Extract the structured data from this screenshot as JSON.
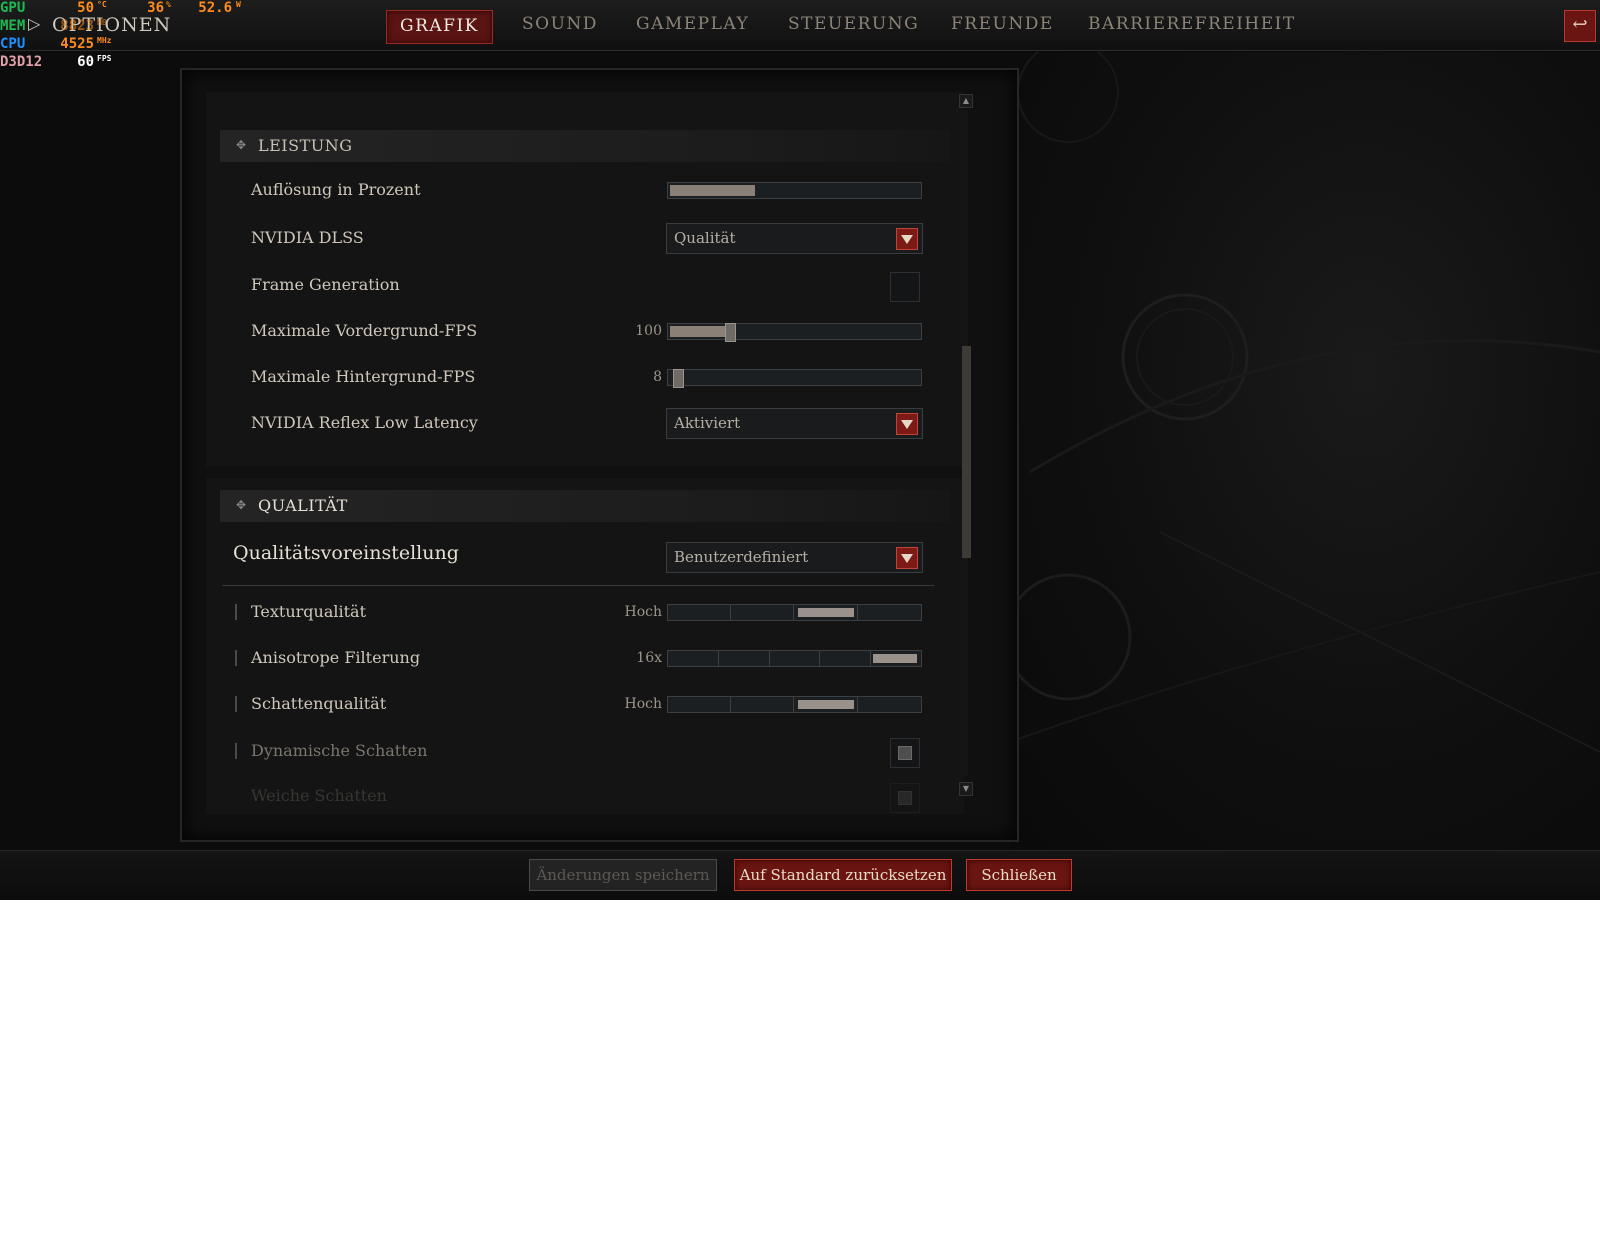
{
  "window": {
    "title": "OPTIONEN"
  },
  "tabs": [
    {
      "label": "GRAFIK",
      "active": true
    },
    {
      "label": "SOUND",
      "active": false
    },
    {
      "label": "GAMEPLAY",
      "active": false
    },
    {
      "label": "STEUERUNG",
      "active": false
    },
    {
      "label": "FREUNDE",
      "active": false
    },
    {
      "label": "BARRIEREFREIHEIT",
      "active": false
    }
  ],
  "back_icon": "return-arrow-icon",
  "perf_overlay": {
    "gpu": {
      "label": "GPU",
      "temp": "50",
      "temp_unit": "°C",
      "load": "36",
      "load_unit": "%",
      "power": "52.6",
      "power_unit": "W"
    },
    "mem": {
      "label": "MEM",
      "value": "8823",
      "unit": "MB"
    },
    "cpu": {
      "label": "CPU",
      "value": "4525",
      "unit": "MHz"
    },
    "api": {
      "label": "D3D12",
      "value": "60",
      "unit": "FPS"
    },
    "colors": {
      "gpu": "#1db954",
      "mem": "#1db954",
      "cpu": "#1e90ff",
      "api": "#e0a0a8",
      "value": "#ff8c1a"
    }
  },
  "sections": {
    "leistung": {
      "title": "LEISTUNG",
      "rows": {
        "aufloesung": {
          "label": "Auflösung in Prozent",
          "fill_fraction": 0.34
        },
        "dlss": {
          "label": "NVIDIA DLSS",
          "selected": "Qualität"
        },
        "framegen": {
          "label": "Frame Generation",
          "checked": false
        },
        "vordergrund": {
          "label": "Maximale Vordergrund-FPS",
          "value": "100",
          "fraction": 0.23
        },
        "hintergrund": {
          "label": "Maximale Hintergrund-FPS",
          "value": "8",
          "fraction": 0.02
        },
        "reflex": {
          "label": "NVIDIA Reflex Low Latency",
          "selected": "Aktiviert"
        }
      }
    },
    "qualitaet": {
      "title": "QUALITÄT",
      "preset": {
        "label": "Qualitätsvoreinstellung",
        "selected": "Benutzerdefiniert"
      },
      "rows": {
        "textur": {
          "label": "Texturqualität",
          "value": "Hoch",
          "steps": 4,
          "level": 3
        },
        "aniso": {
          "label": "Anisotrope Filterung",
          "value": "16x",
          "steps": 5,
          "level": 5
        },
        "schatten": {
          "label": "Schattenqualität",
          "value": "Hoch",
          "steps": 4,
          "level": 3
        },
        "dynschatten": {
          "label": "Dynamische Schatten",
          "checked": true
        },
        "weicheschatten": {
          "label": "Weiche Schatten"
        }
      }
    }
  },
  "footer": {
    "save_label": "Änderungen speichern",
    "reset_label": "Auf Standard zurücksetzen",
    "close_label": "Schließen"
  },
  "colors": {
    "accent_red": "#7c1a16",
    "panel_bg": "#101010",
    "text": "#cfc7bb"
  }
}
